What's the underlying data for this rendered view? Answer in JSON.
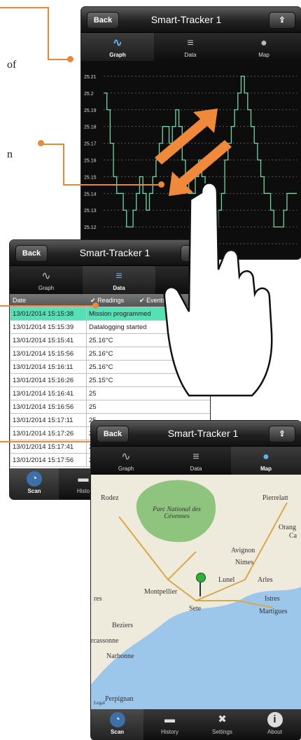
{
  "side_text": {
    "of": "of",
    "n": "n"
  },
  "graph_screen": {
    "back": "Back",
    "title": "Smart-Tracker 1",
    "tabs": [
      {
        "label": "Graph",
        "icon": "graph-icon",
        "active": true
      },
      {
        "label": "Data",
        "icon": "database-icon",
        "active": false
      },
      {
        "label": "Map",
        "icon": "globe-icon",
        "active": false
      }
    ],
    "y_ticks": [
      "25.21",
      "25.2",
      "25.19",
      "25.18",
      "25.17",
      "25.16",
      "25.15",
      "25.14",
      "25.13",
      "25.12",
      "25.11"
    ],
    "line_color": "#6fd6a8"
  },
  "chart_data": {
    "type": "line",
    "title": "",
    "xlabel": "",
    "ylabel": "",
    "ylim": [
      25.105,
      25.215
    ],
    "grid": true,
    "x": [
      0,
      1,
      2,
      3,
      4,
      5,
      6,
      7,
      8,
      9,
      10,
      11,
      12,
      13,
      14,
      15,
      16,
      17,
      18,
      19,
      20,
      21,
      22,
      23,
      24,
      25,
      26,
      27,
      28,
      29,
      30,
      31,
      32,
      33,
      34,
      35,
      36,
      37,
      38,
      39,
      40,
      41,
      42,
      43,
      44,
      45,
      46,
      47,
      48,
      49,
      50,
      51,
      52,
      53,
      54,
      55,
      56,
      57,
      58,
      59
    ],
    "y": [
      25.2,
      25.19,
      25.17,
      25.15,
      25.14,
      25.14,
      25.13,
      25.12,
      25.12,
      25.13,
      25.14,
      25.15,
      25.14,
      25.13,
      25.14,
      25.15,
      25.16,
      25.17,
      25.18,
      25.18,
      25.17,
      25.18,
      25.19,
      25.18,
      25.16,
      25.15,
      25.14,
      25.14,
      25.15,
      25.16,
      25.15,
      25.14,
      25.13,
      25.12,
      25.12,
      25.13,
      25.14,
      25.16,
      25.17,
      25.18,
      25.19,
      25.2,
      25.21,
      25.2,
      25.19,
      25.18,
      25.17,
      25.16,
      25.15,
      25.14,
      25.14,
      25.13,
      25.12,
      25.12,
      25.12,
      25.13,
      25.14,
      25.14,
      25.14,
      25.14
    ]
  },
  "data_screen": {
    "back": "Back",
    "title": "Smart-Tracker 1",
    "tabs": [
      {
        "label": "Graph",
        "icon": "graph-icon",
        "active": false
      },
      {
        "label": "Data",
        "icon": "database-icon",
        "active": true
      }
    ],
    "header": {
      "col1": "Date",
      "filter1": "Readings",
      "filter2": "Events/Al"
    },
    "rows": [
      {
        "date": "13/01/2014 15:15:38",
        "value": "Mission programmed",
        "highlight": true
      },
      {
        "date": "13/01/2014 15:15:39",
        "value": "Datalogging started",
        "highlight": false
      },
      {
        "date": "13/01/2014 15:15:41",
        "value": "25.16°C",
        "highlight": false
      },
      {
        "date": "13/01/2014 15:15:56",
        "value": "25.16°C",
        "highlight": false
      },
      {
        "date": "13/01/2014 15:16:11",
        "value": "25.16°C",
        "highlight": false
      },
      {
        "date": "13/01/2014 15:16:26",
        "value": "25.15°C",
        "highlight": false
      },
      {
        "date": "13/01/2014 15:16:41",
        "value": "25",
        "highlight": false
      },
      {
        "date": "13/01/2014 15:16:56",
        "value": "25",
        "highlight": false
      },
      {
        "date": "13/01/2014 15:17:11",
        "value": "25",
        "highlight": false
      },
      {
        "date": "13/01/2014 15:17:26",
        "value": "25",
        "highlight": false
      },
      {
        "date": "13/01/2014 15:17:41",
        "value": "25",
        "highlight": false
      },
      {
        "date": "13/01/2014 15:17:56",
        "value": "25",
        "highlight": false
      }
    ],
    "bottom_tabs": [
      {
        "label": "Scan",
        "icon": "scan-icon",
        "active": true
      },
      {
        "label": "Histo",
        "icon": "folder-icon",
        "active": false
      }
    ]
  },
  "map_screen": {
    "back": "Back",
    "title": "Smart-Tracker 1",
    "tabs": [
      {
        "label": "Graph",
        "icon": "graph-icon",
        "active": false
      },
      {
        "label": "Data",
        "icon": "database-icon",
        "active": false
      },
      {
        "label": "Map",
        "icon": "globe-icon",
        "active": true
      }
    ],
    "places": {
      "rodez": "Rodez",
      "park": "Parc National des Cévennes",
      "pierrelatte": "Pierrelatt",
      "orange": "Orang",
      "ca": "Ca",
      "avignon": "Avignon",
      "nimes": "Nimes",
      "lunel": "Lunel",
      "arles": "Arles",
      "montpellier": "Montpellier",
      "res": "res",
      "sete": "Sete",
      "istres": "Istres",
      "martigues": "Martigues",
      "beziers": "Beziers",
      "rcassonne": "rcassonne",
      "narbonne": "Narbonne",
      "perpignan": "Perpignan",
      "legal": "Legal"
    },
    "bottom_tabs": [
      {
        "label": "Scan",
        "icon": "scan-icon",
        "active": true
      },
      {
        "label": "History",
        "icon": "folder-icon",
        "active": false
      },
      {
        "label": "Settings",
        "icon": "tools-icon",
        "active": false
      },
      {
        "label": "About",
        "icon": "info-icon",
        "active": false
      }
    ]
  },
  "colors": {
    "accent": "#e8893a",
    "highlight_row": "#55e1b6",
    "map_sea": "#9cc6ea",
    "map_land": "#eeeadc",
    "park": "#8fc47e"
  }
}
